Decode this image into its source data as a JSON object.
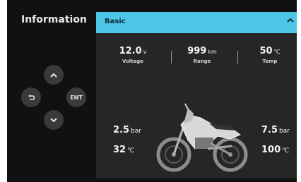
{
  "sidebar": {
    "title": "Information"
  },
  "pad": {
    "up_icon": "chevron-up-icon",
    "down_icon": "chevron-down-icon",
    "back_icon": "back-arrow-icon",
    "ent_label": "ENT"
  },
  "panel": {
    "header": {
      "label": "Basic",
      "chevron": "chevron-up-icon",
      "color": "#4cc6e6"
    },
    "stats": [
      {
        "value": "12.0",
        "unit": "v",
        "label": "Voltage"
      },
      {
        "value": "999",
        "unit": "km",
        "label": "Range"
      },
      {
        "value": "50",
        "unit": "℃",
        "label": "Temp"
      }
    ],
    "front_tire": {
      "pressure": "2.5",
      "pressure_unit": "bar",
      "temp": "32",
      "temp_unit": "℃"
    },
    "rear_tire": {
      "pressure": "7.5",
      "pressure_unit": "bar",
      "temp": "100",
      "temp_unit": "℃"
    },
    "bike_icon": "motorcycle-image"
  }
}
